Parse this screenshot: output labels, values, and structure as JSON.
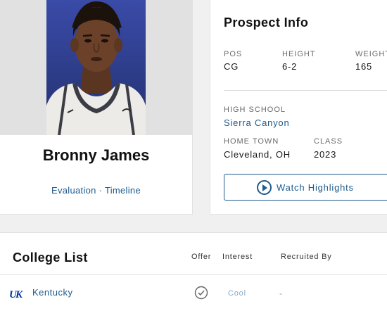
{
  "player": {
    "name": "Bronny James",
    "links": {
      "evaluation": "Evaluation",
      "separator": "·",
      "timeline": "Timeline"
    }
  },
  "prospect_info": {
    "title": "Prospect Info",
    "pos": {
      "label": "POS",
      "value": "CG"
    },
    "height": {
      "label": "HEIGHT",
      "value": "6-2"
    },
    "weight": {
      "label": "WEIGHT",
      "value": "165"
    },
    "high_school": {
      "label": "HIGH SCHOOL",
      "value": "Sierra Canyon"
    },
    "home_town": {
      "label": "HOME TOWN",
      "value": "Cleveland, OH"
    },
    "class": {
      "label": "CLASS",
      "value": "2023"
    },
    "watch_button": "Watch Highlights"
  },
  "college_list": {
    "title": "College List",
    "columns": {
      "offer": "Offer",
      "interest": "Interest",
      "recruited_by": "Recruited By"
    },
    "rows": [
      {
        "logo_text": "UK",
        "school": "Kentucky",
        "offer": true,
        "interest": "Cool",
        "recruited_by": "-"
      }
    ]
  },
  "colors": {
    "link": "#1f5a8c",
    "kentucky_blue": "#0033a0",
    "photo_background": "#2d3c8c"
  },
  "icons": [
    "play-circle-icon",
    "check-circle-icon",
    "kentucky-logo"
  ]
}
